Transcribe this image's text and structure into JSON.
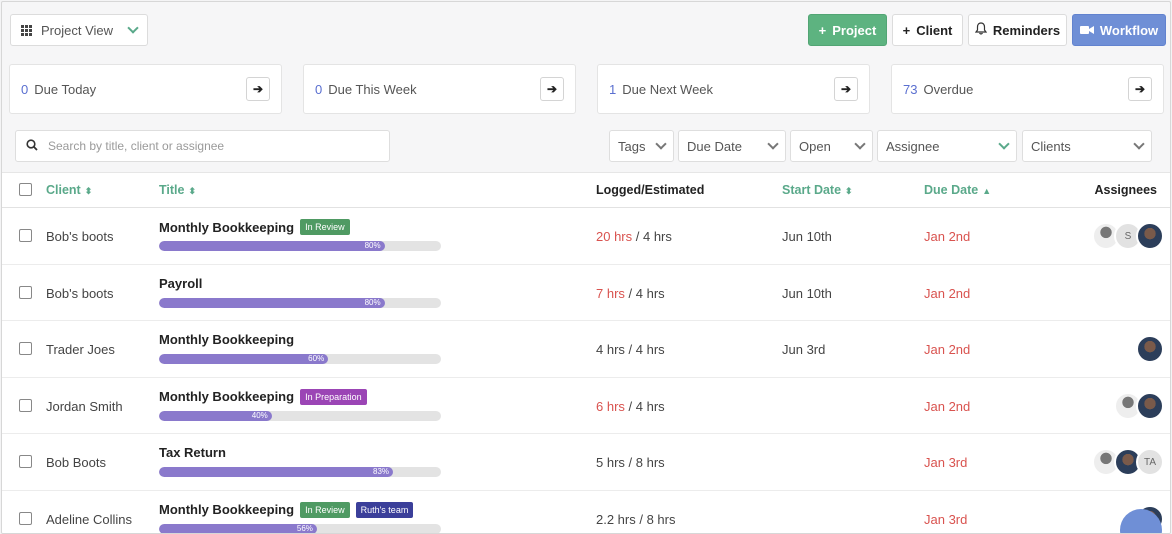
{
  "toolbar": {
    "view_label": "Project View",
    "buttons": {
      "project": "Project",
      "client": "Client",
      "reminders": "Reminders",
      "workflow": "Workflow"
    }
  },
  "cards": [
    {
      "count": "0",
      "label": "Due Today"
    },
    {
      "count": "0",
      "label": "Due This Week"
    },
    {
      "count": "1",
      "label": "Due Next Week"
    },
    {
      "count": "73",
      "label": "Overdue"
    }
  ],
  "search": {
    "placeholder": "Search by title, client or assignee"
  },
  "filters": {
    "tags": "Tags",
    "due_date": "Due Date",
    "status": "Open",
    "assignee": "Assignee",
    "clients": "Clients"
  },
  "table": {
    "headers": {
      "client": "Client",
      "title": "Title",
      "logged": "Logged/Estimated",
      "start": "Start Date",
      "due": "Due Date",
      "assignees": "Assignees"
    },
    "rows": [
      {
        "client": "Bob's boots",
        "title": "Monthly Bookkeeping",
        "badges": [
          {
            "text": "In Review",
            "color": "#4f9a63"
          }
        ],
        "progress": 80,
        "progress_label": "80%",
        "logged": "20 hrs",
        "logged_over": true,
        "estimated": " / 4 hrs",
        "start": "Jun 10th",
        "due": "Jan 2nd",
        "assignees": [
          "photo",
          "initials:S",
          "statue"
        ]
      },
      {
        "client": "Bob's boots",
        "title": "Payroll",
        "badges": [],
        "progress": 80,
        "progress_label": "80%",
        "logged": "7 hrs",
        "logged_over": true,
        "estimated": " / 4 hrs",
        "start": "Jun 10th",
        "due": "Jan 2nd",
        "assignees": []
      },
      {
        "client": "Trader Joes",
        "title": "Monthly Bookkeeping",
        "badges": [],
        "progress": 60,
        "progress_label": "60%",
        "logged": "4 hrs",
        "logged_over": false,
        "estimated": " / 4 hrs",
        "start": "Jun 3rd",
        "due": "Jan 2nd",
        "assignees": [
          "photo"
        ]
      },
      {
        "client": "Jordan Smith",
        "title": "Monthly Bookkeeping",
        "badges": [
          {
            "text": "In Preparation",
            "color": "#9b45b5"
          }
        ],
        "progress": 40,
        "progress_label": "40%",
        "logged": "6 hrs",
        "logged_over": true,
        "estimated": " / 4 hrs",
        "start": "",
        "due": "Jan 2nd",
        "assignees": [
          "photo",
          "statue"
        ]
      },
      {
        "client": "Bob Boots",
        "title": "Tax Return",
        "badges": [],
        "progress": 83,
        "progress_label": "83%",
        "logged": "5 hrs",
        "logged_over": false,
        "estimated": " / 8 hrs",
        "start": "",
        "due": "Jan 3rd",
        "assignees": [
          "initials:TA",
          "photo",
          "statue"
        ]
      },
      {
        "client": "Adeline Collins",
        "title": "Monthly Bookkeeping",
        "badges": [
          {
            "text": "In Review",
            "color": "#4f9a63"
          },
          {
            "text": "Ruth's team",
            "color": "#3b3f9a"
          }
        ],
        "progress": 56,
        "progress_label": "56%",
        "logged": "2.2 hrs",
        "logged_over": false,
        "estimated": " / 8 hrs",
        "start": "",
        "due": "Jan 3rd",
        "assignees": [
          "photo"
        ]
      }
    ]
  },
  "colors": {
    "accent_green": "#5db380",
    "accent_blue": "#6f8fd6",
    "overdue_red": "#d9534f",
    "progress": "#8a79cc"
  }
}
